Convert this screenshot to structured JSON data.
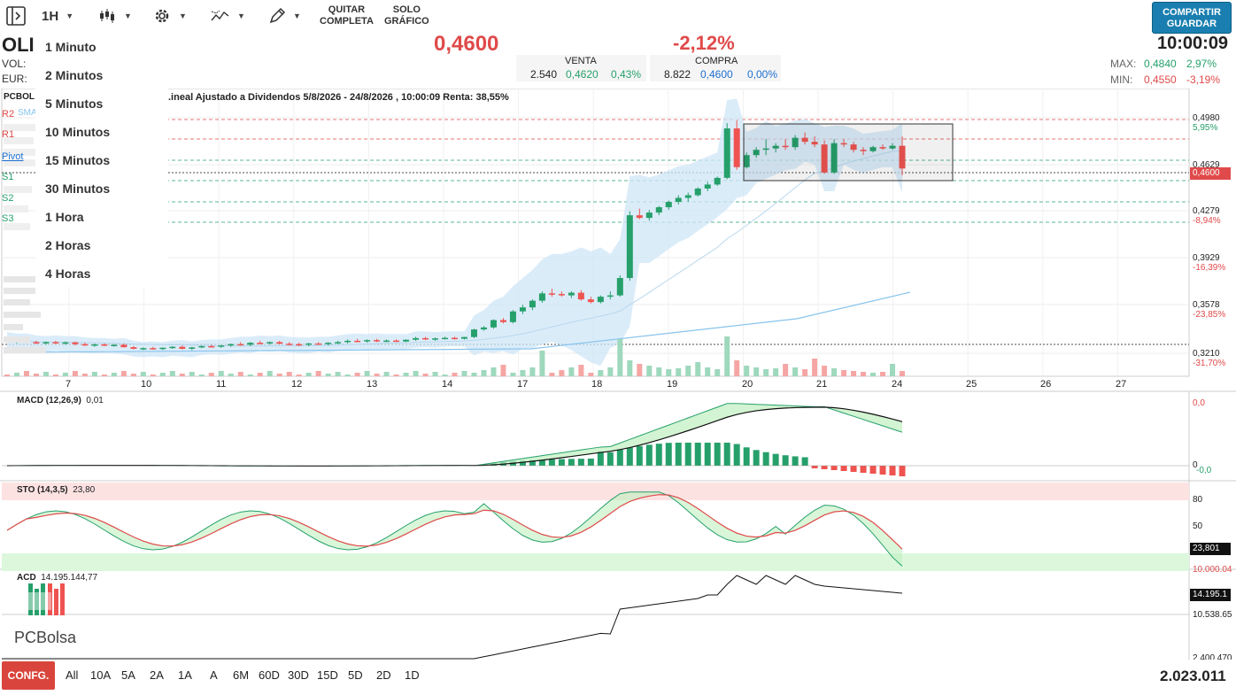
{
  "toolbar": {
    "timeframe": "1H",
    "quit_full_label": "QUITAR\nCOMPLETA",
    "chart_only_label": "SOLO\nGRÁFICO",
    "share_label": "COMPARTIR\nGUARDAR"
  },
  "quote": {
    "ticker": "OLI",
    "vol_label": "VOL:",
    "eur_label": "EUR:",
    "price": "0,4600",
    "change": "-2,12%",
    "time": "10:00:09",
    "sell": {
      "label": "VENTA",
      "qty": "2.540",
      "price": "0,4620",
      "pct": "0,43%"
    },
    "buy": {
      "label": "COMPRA",
      "qty": "8.822",
      "price": "0,4600",
      "pct": "0,00%"
    },
    "max": {
      "label": "MAX:",
      "value": "0,4840",
      "pct": "2,97%"
    },
    "min": {
      "label": "MIN:",
      "value": "0,4550",
      "pct": "-3,19%"
    }
  },
  "timeframe_menu": [
    "1 Minuto",
    "2 Minutos",
    "5 Minutos",
    "10 Minutos",
    "15 Minutos",
    "30 Minutos",
    "1 Hora",
    "2 Horas",
    "4 Horas"
  ],
  "chart_header": {
    "source": "PCBOL",
    "subtitle": ".ineal Ajustado a Dividendos 5/8/2026 - 24/8/2026 , 10:00:09 Renta: 38,55%",
    "sma_label": "SMA",
    "levels": [
      "R2",
      "R1",
      "Pivot",
      "S1",
      "S2",
      "S3"
    ]
  },
  "price_axis": {
    "ticks": [
      "0,4980",
      "0,4629",
      "0,4279",
      "0,3929",
      "0,3578",
      "0,3210"
    ],
    "pcts": [
      "5,95%",
      "-8,94%",
      "-16,39%",
      "-23,85%",
      "-31,70%"
    ],
    "last": "0,4600"
  },
  "x_axis": [
    "7",
    "10",
    "11",
    "12",
    "13",
    "14",
    "17",
    "18",
    "19",
    "20",
    "21",
    "24",
    "25",
    "26",
    "27"
  ],
  "macd": {
    "label": "MACD (12,26,9)",
    "value": "0,01",
    "ticks": [
      "0,0",
      "0",
      "-0,0"
    ]
  },
  "sto": {
    "label": "STO (14,3,5)",
    "value": "23,80",
    "ticks": [
      "80",
      "50"
    ],
    "last": "23,801"
  },
  "acd": {
    "label": "ACD",
    "value": "14.195.144,77",
    "ticks": [
      "10.000.04",
      "10.538.65",
      "2.400.470"
    ],
    "last": "14.195.1"
  },
  "logo": "PCBolsa",
  "bottom": {
    "config_label": "CONFG.",
    "ranges": [
      "All",
      "10A",
      "5A",
      "2A",
      "1A",
      "A",
      "6M",
      "60D",
      "30D",
      "15D",
      "5D",
      "2D",
      "1D"
    ],
    "volume_total": "2.023.011"
  },
  "colors": {
    "up": "#26a06b",
    "down": "#ef5350",
    "accent": "#1a7fb0",
    "price_red": "#e04a4a",
    "blue": "#1e6fd0"
  },
  "chart_data": {
    "type": "candlestick",
    "ylim": [
      0.321,
      0.498
    ],
    "candles": [
      [
        0.332,
        0.3335,
        0.33,
        0.3305
      ],
      [
        0.3305,
        0.3325,
        0.329,
        0.3315
      ],
      [
        0.3315,
        0.3325,
        0.3295,
        0.33
      ],
      [
        0.33,
        0.331,
        0.3285,
        0.329
      ],
      [
        0.329,
        0.3305,
        0.328,
        0.33
      ],
      [
        0.33,
        0.331,
        0.3285,
        0.3292
      ],
      [
        0.3292,
        0.3305,
        0.328,
        0.3298
      ],
      [
        0.3298,
        0.3305,
        0.3275,
        0.3285
      ],
      [
        0.3285,
        0.3295,
        0.327,
        0.3278
      ],
      [
        0.3278,
        0.329,
        0.3265,
        0.3283
      ],
      [
        0.3283,
        0.329,
        0.327,
        0.3275
      ],
      [
        0.3275,
        0.3285,
        0.3265,
        0.328
      ],
      [
        0.328,
        0.329,
        0.326,
        0.3262
      ],
      [
        0.3262,
        0.327,
        0.3245,
        0.325
      ],
      [
        0.325,
        0.326,
        0.324,
        0.3255
      ],
      [
        0.3255,
        0.3265,
        0.3245,
        0.3248
      ],
      [
        0.3248,
        0.326,
        0.324,
        0.3258
      ],
      [
        0.3258,
        0.327,
        0.325,
        0.3265
      ],
      [
        0.3265,
        0.3275,
        0.3245,
        0.325
      ],
      [
        0.325,
        0.3265,
        0.324,
        0.326
      ],
      [
        0.326,
        0.3275,
        0.3255,
        0.327
      ],
      [
        0.327,
        0.328,
        0.326,
        0.3265
      ],
      [
        0.3265,
        0.328,
        0.3258,
        0.3275
      ],
      [
        0.3275,
        0.329,
        0.3265,
        0.3285
      ],
      [
        0.3285,
        0.33,
        0.3275,
        0.328
      ],
      [
        0.328,
        0.33,
        0.327,
        0.3295
      ],
      [
        0.3295,
        0.331,
        0.3285,
        0.329
      ],
      [
        0.329,
        0.3305,
        0.328,
        0.33
      ],
      [
        0.33,
        0.331,
        0.3285,
        0.3288
      ],
      [
        0.3288,
        0.33,
        0.3275,
        0.3285
      ],
      [
        0.3285,
        0.3295,
        0.327,
        0.328
      ],
      [
        0.328,
        0.3295,
        0.327,
        0.329
      ],
      [
        0.329,
        0.33,
        0.328,
        0.3285
      ],
      [
        0.3285,
        0.33,
        0.3275,
        0.3295
      ],
      [
        0.3295,
        0.331,
        0.3285,
        0.33
      ],
      [
        0.33,
        0.332,
        0.329,
        0.331
      ],
      [
        0.331,
        0.3325,
        0.33,
        0.3305
      ],
      [
        0.3305,
        0.332,
        0.3295,
        0.3315
      ],
      [
        0.3315,
        0.3325,
        0.33,
        0.3308
      ],
      [
        0.3308,
        0.332,
        0.33,
        0.3312
      ],
      [
        0.3312,
        0.332,
        0.33,
        0.3305
      ],
      [
        0.3305,
        0.332,
        0.33,
        0.3318
      ],
      [
        0.3318,
        0.334,
        0.331,
        0.333
      ],
      [
        0.333,
        0.334,
        0.3315,
        0.332
      ],
      [
        0.332,
        0.3335,
        0.331,
        0.3328
      ],
      [
        0.3328,
        0.334,
        0.332,
        0.3332
      ],
      [
        0.3332,
        0.334,
        0.332,
        0.3325
      ],
      [
        0.3325,
        0.334,
        0.332,
        0.3338
      ],
      [
        0.3338,
        0.34,
        0.333,
        0.3395
      ],
      [
        0.3395,
        0.342,
        0.3385,
        0.341
      ],
      [
        0.341,
        0.347,
        0.34,
        0.3465
      ],
      [
        0.3465,
        0.348,
        0.344,
        0.345
      ],
      [
        0.345,
        0.354,
        0.344,
        0.353
      ],
      [
        0.353,
        0.358,
        0.351,
        0.356
      ],
      [
        0.356,
        0.362,
        0.354,
        0.361
      ],
      [
        0.361,
        0.368,
        0.3595,
        0.3665
      ],
      [
        0.3665,
        0.37,
        0.364,
        0.366
      ],
      [
        0.366,
        0.368,
        0.364,
        0.365
      ],
      [
        0.365,
        0.368,
        0.363,
        0.367
      ],
      [
        0.367,
        0.369,
        0.361,
        0.362
      ],
      [
        0.362,
        0.364,
        0.359,
        0.36
      ],
      [
        0.36,
        0.365,
        0.359,
        0.364
      ],
      [
        0.364,
        0.368,
        0.362,
        0.365
      ],
      [
        0.365,
        0.38,
        0.364,
        0.378
      ],
      [
        0.378,
        0.428,
        0.376,
        0.425
      ],
      [
        0.425,
        0.43,
        0.422,
        0.423
      ],
      [
        0.423,
        0.429,
        0.421,
        0.427
      ],
      [
        0.427,
        0.432,
        0.425,
        0.431
      ],
      [
        0.431,
        0.436,
        0.429,
        0.435
      ],
      [
        0.435,
        0.44,
        0.433,
        0.438
      ],
      [
        0.438,
        0.442,
        0.435,
        0.44
      ],
      [
        0.44,
        0.446,
        0.439,
        0.445
      ],
      [
        0.445,
        0.45,
        0.443,
        0.448
      ],
      [
        0.448,
        0.454,
        0.447,
        0.453
      ],
      [
        0.453,
        0.494,
        0.452,
        0.49
      ],
      [
        0.49,
        0.496,
        0.459,
        0.461
      ],
      [
        0.461,
        0.472,
        0.46,
        0.47
      ],
      [
        0.47,
        0.476,
        0.468,
        0.474
      ],
      [
        0.474,
        0.482,
        0.47,
        0.475
      ],
      [
        0.475,
        0.479,
        0.472,
        0.477
      ],
      [
        0.477,
        0.482,
        0.474,
        0.476
      ],
      [
        0.476,
        0.485,
        0.474,
        0.483
      ],
      [
        0.483,
        0.487,
        0.478,
        0.48
      ],
      [
        0.48,
        0.484,
        0.476,
        0.478
      ],
      [
        0.478,
        0.481,
        0.456,
        0.457
      ],
      [
        0.457,
        0.482,
        0.456,
        0.479
      ],
      [
        0.479,
        0.482,
        0.476,
        0.478
      ],
      [
        0.478,
        0.48,
        0.472,
        0.474
      ],
      [
        0.474,
        0.476,
        0.47,
        0.473
      ],
      [
        0.473,
        0.477,
        0.472,
        0.476
      ],
      [
        0.476,
        0.478,
        0.474,
        0.475
      ],
      [
        0.475,
        0.479,
        0.474,
        0.477
      ],
      [
        0.477,
        0.484,
        0.455,
        0.46
      ]
    ]
  }
}
